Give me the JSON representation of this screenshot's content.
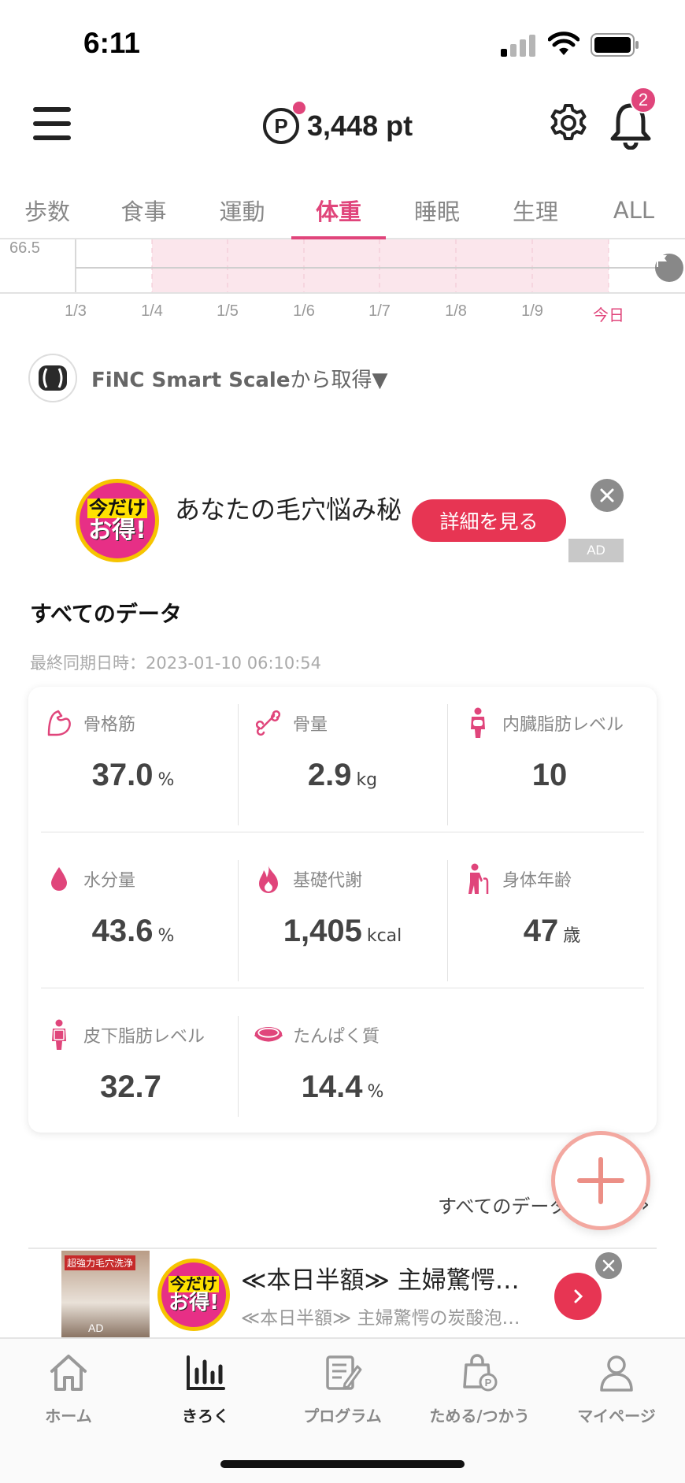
{
  "status_bar": {
    "time": "6:11"
  },
  "header": {
    "points_symbol": "P",
    "points": "3,448 pt",
    "notification_count": "2"
  },
  "tabs": [
    {
      "label": "歩数",
      "active": false
    },
    {
      "label": "食事",
      "active": false
    },
    {
      "label": "運動",
      "active": false
    },
    {
      "label": "体重",
      "active": true
    },
    {
      "label": "睡眠",
      "active": false
    },
    {
      "label": "生理",
      "active": false
    },
    {
      "label": "ALL",
      "active": false
    }
  ],
  "chart": {
    "y_label": "66.5",
    "x_labels": [
      "1/3",
      "1/4",
      "1/5",
      "1/6",
      "1/7",
      "1/8",
      "1/9",
      "今日"
    ]
  },
  "source": {
    "brand": "FiNC Smart Scale",
    "suffix": "から取得▼"
  },
  "ad1": {
    "badge_line1": "今だけ",
    "badge_line2": "お得!",
    "title": "あなたの毛穴悩み秘",
    "cta": "詳細を見る",
    "ad_tag": "AD"
  },
  "all_data": {
    "title": "すべてのデータ",
    "sync_time": "最終同期日時：2023-01-10 06:10:54",
    "cells": [
      {
        "label": "骨格筋",
        "value": "37.0",
        "unit": "%",
        "icon": "muscle-icon"
      },
      {
        "label": "骨量",
        "value": "2.9",
        "unit": "kg",
        "icon": "bone-icon"
      },
      {
        "label": "内臓脂肪レベル",
        "value": "10",
        "unit": "",
        "icon": "visceral-fat-icon"
      },
      {
        "label": "水分量",
        "value": "43.6",
        "unit": "%",
        "icon": "water-drop-icon"
      },
      {
        "label": "基礎代謝",
        "value": "1,405",
        "unit": "kcal",
        "icon": "flame-icon"
      },
      {
        "label": "身体年齢",
        "value": "47",
        "unit": "歳",
        "icon": "elderly-person-icon"
      },
      {
        "label": "皮下脂肪レベル",
        "value": "32.7",
        "unit": "",
        "icon": "body-fat-icon"
      },
      {
        "label": "たんぱく質",
        "value": "14.4",
        "unit": "%",
        "icon": "meat-icon"
      }
    ],
    "see_all": "すべてのデータ"
  },
  "ad2": {
    "photo_caption": "超強力毛穴洗浄",
    "photo_ad": "AD",
    "badge_line1": "今だけ",
    "badge_line2": "お得!",
    "title": "≪本日半額≫ 主婦驚愕…",
    "subtitle": "≪本日半額≫ 主婦驚愕の炭酸泡…"
  },
  "bottom_nav": [
    {
      "label": "ホーム",
      "icon": "home-icon",
      "active": false
    },
    {
      "label": "きろく",
      "icon": "chart-icon",
      "active": true
    },
    {
      "label": "プログラム",
      "icon": "program-icon",
      "active": false
    },
    {
      "label": "ためる/つかう",
      "icon": "points-bag-icon",
      "active": false
    },
    {
      "label": "マイページ",
      "icon": "user-icon",
      "active": false
    }
  ],
  "colors": {
    "accent": "#e0457b",
    "cta": "#e73553",
    "chart_band": "#fbe6ec"
  }
}
